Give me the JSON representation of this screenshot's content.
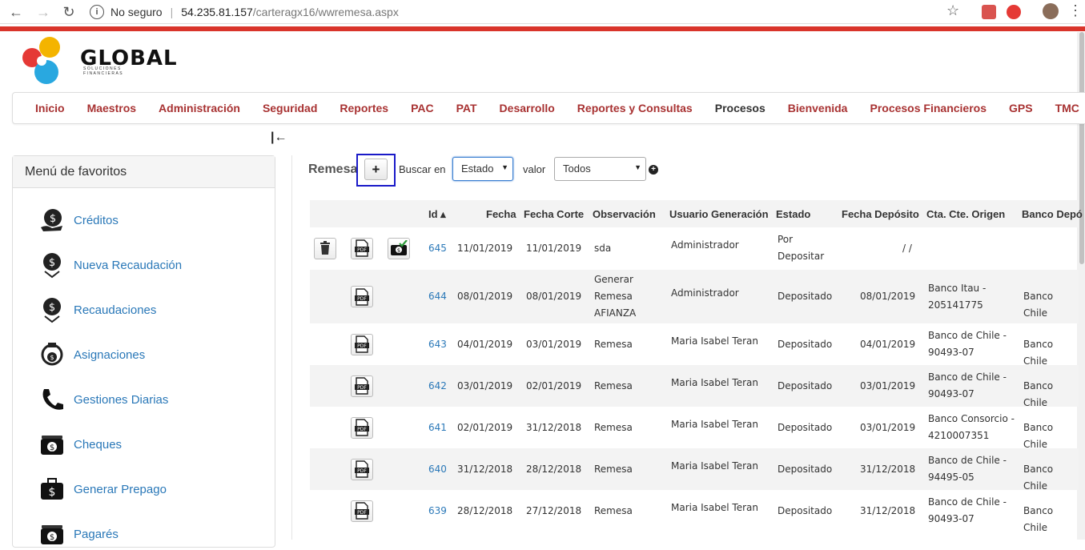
{
  "browser": {
    "security": "No seguro",
    "url_host": "54.235.81.157",
    "url_path": "/carteragx16/wwremesa.aspx"
  },
  "logo": {
    "name": "GLOBAL",
    "tagline": "SOLUCIONES FINANCIERAS"
  },
  "menu": [
    {
      "label": "Inicio"
    },
    {
      "label": "Maestros"
    },
    {
      "label": "Administración"
    },
    {
      "label": "Seguridad"
    },
    {
      "label": "Reportes"
    },
    {
      "label": "PAC"
    },
    {
      "label": "PAT"
    },
    {
      "label": "Desarrollo"
    },
    {
      "label": "Reportes y Consultas"
    },
    {
      "label": "Procesos"
    },
    {
      "label": "Bienvenida"
    },
    {
      "label": "Procesos Financieros"
    },
    {
      "label": "GPS"
    },
    {
      "label": "TMC"
    }
  ],
  "favorites": {
    "title": "Menú de favoritos",
    "items": [
      {
        "label": "Créditos",
        "icon": "money-hand-icon"
      },
      {
        "label": "Nueva Recaudación",
        "icon": "money-down-icon"
      },
      {
        "label": "Recaudaciones",
        "icon": "money-down-icon"
      },
      {
        "label": "Asignaciones",
        "icon": "money-cycle-icon"
      },
      {
        "label": "Gestiones Diarias",
        "icon": "phone-icon"
      },
      {
        "label": "Cheques",
        "icon": "cash-stack-icon"
      },
      {
        "label": "Generar Prepago",
        "icon": "briefcase-money-icon"
      },
      {
        "label": "Pagarés",
        "icon": "cash-stack-icon"
      }
    ]
  },
  "toolbar": {
    "title": "Remesa",
    "add_label": "+",
    "search_in_label": "Buscar en",
    "search_field": "Estado",
    "value_label": "valor",
    "value_selected": "Todos"
  },
  "table": {
    "columns": [
      "Id ▴",
      "Fecha",
      "Fecha Corte",
      "Observación",
      "Usuario Generación",
      "Estado",
      "Fecha Depósito",
      "Cta. Cte. Origen",
      "Banco Depó"
    ],
    "rows": [
      {
        "id": "645",
        "fecha": "11/01/2019",
        "corte": "11/01/2019",
        "obs": [
          "sda"
        ],
        "usuario": "Administrador",
        "estado": [
          "Por",
          "Depositar"
        ],
        "deposito": "/ /",
        "cta": [],
        "banco": ""
      },
      {
        "id": "644",
        "fecha": "08/01/2019",
        "corte": "08/01/2019",
        "obs": [
          "Generar",
          "Remesa",
          "AFIANZA"
        ],
        "usuario": "Administrador",
        "estado": [
          "Depositado"
        ],
        "deposito": "08/01/2019",
        "cta": [
          "Banco Itau -",
          "205141775"
        ],
        "banco": "Banco Chile"
      },
      {
        "id": "643",
        "fecha": "04/01/2019",
        "corte": "03/01/2019",
        "obs": [
          "Remesa"
        ],
        "usuario": "Maria Isabel Teran",
        "estado": [
          "Depositado"
        ],
        "deposito": "04/01/2019",
        "cta": [
          "Banco de Chile -",
          "90493-07"
        ],
        "banco": "Banco Chile"
      },
      {
        "id": "642",
        "fecha": "03/01/2019",
        "corte": "02/01/2019",
        "obs": [
          "Remesa"
        ],
        "usuario": "Maria Isabel Teran",
        "estado": [
          "Depositado"
        ],
        "deposito": "03/01/2019",
        "cta": [
          "Banco de Chile -",
          "90493-07"
        ],
        "banco": "Banco Chile"
      },
      {
        "id": "641",
        "fecha": "02/01/2019",
        "corte": "31/12/2018",
        "obs": [
          "Remesa"
        ],
        "usuario": "Maria Isabel Teran",
        "estado": [
          "Depositado"
        ],
        "deposito": "03/01/2019",
        "cta": [
          "Banco Consorcio -",
          "4210007351"
        ],
        "banco": "Banco Chile"
      },
      {
        "id": "640",
        "fecha": "31/12/2018",
        "corte": "28/12/2018",
        "obs": [
          "Remesa"
        ],
        "usuario": "Maria Isabel Teran",
        "estado": [
          "Depositado"
        ],
        "deposito": "31/12/2018",
        "cta": [
          "Banco de Chile -",
          "94495-05"
        ],
        "banco": "Banco Chile"
      },
      {
        "id": "639",
        "fecha": "28/12/2018",
        "corte": "27/12/2018",
        "obs": [
          "Remesa"
        ],
        "usuario": "Maria Isabel Teran",
        "estado": [
          "Depositado"
        ],
        "deposito": "31/12/2018",
        "cta": [
          "Banco de Chile -",
          "90493-07"
        ],
        "banco": "Banco Chile"
      }
    ]
  },
  "colors": {
    "accent_red": "#d9342b",
    "menu_text": "#a83232",
    "link_blue": "#2a78b8",
    "highlight_box": "#1a1ac8"
  }
}
